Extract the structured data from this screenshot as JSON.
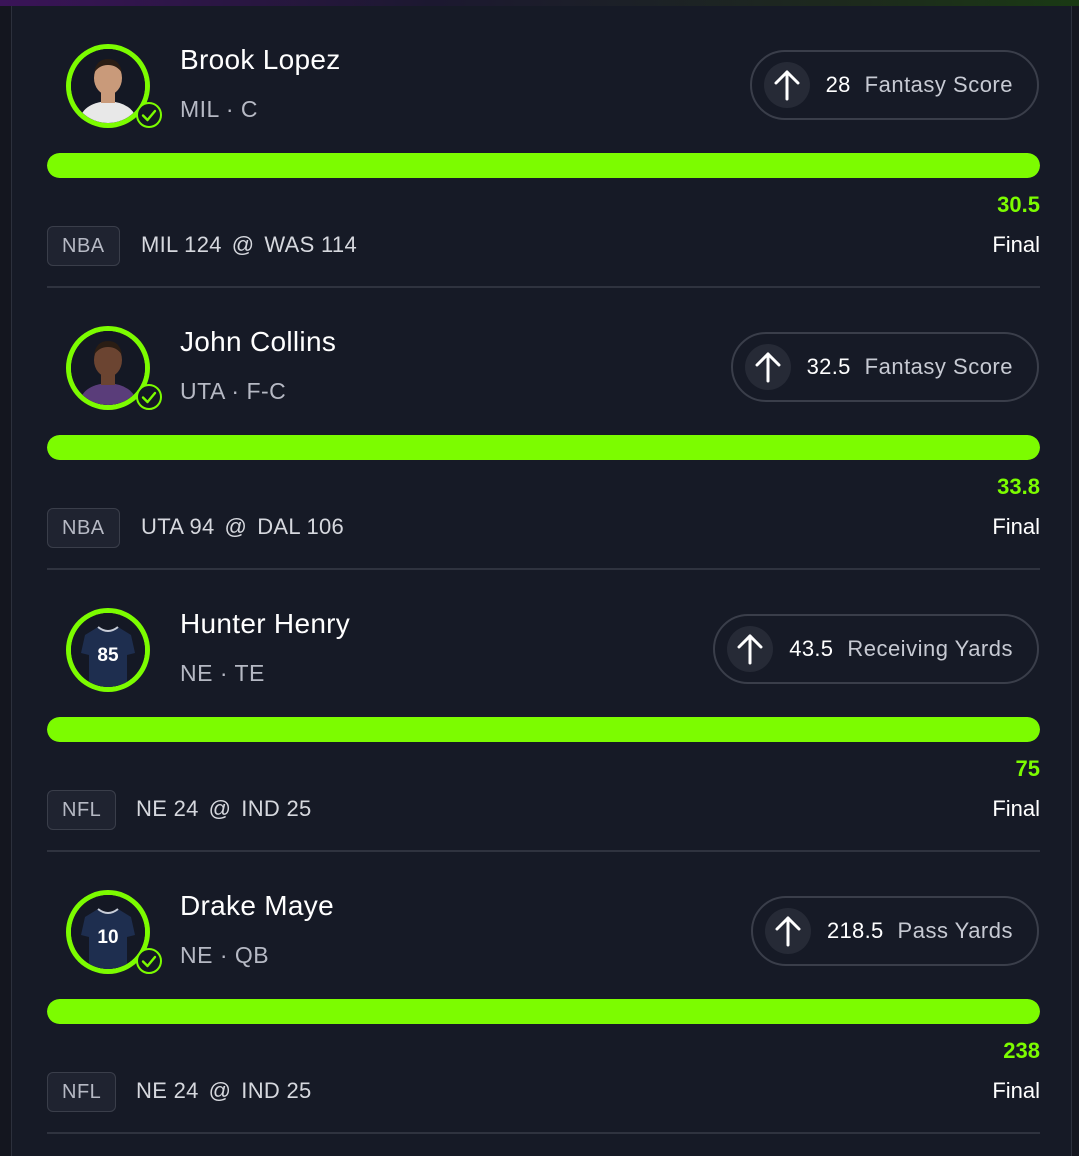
{
  "colors": {
    "accent": "#7cfc00",
    "background": "#161a26",
    "text": "#ffffff",
    "muted": "#b6b9c4"
  },
  "picks": [
    {
      "player_name": "Brook Lopez",
      "team_position": "MIL · C",
      "direction_icon": "arrow-up-icon",
      "line": "28",
      "stat_type": "Fantasy Score",
      "progress": 1.0,
      "actual": "30.5",
      "league": "NBA",
      "away_team": "MIL 124",
      "at": "@",
      "home_team": "WAS 114",
      "status": "Final",
      "avatar": "basketball-headshot",
      "jersey_number": "",
      "checked": true
    },
    {
      "player_name": "John Collins",
      "team_position": "UTA · F-C",
      "direction_icon": "arrow-up-icon",
      "line": "32.5",
      "stat_type": "Fantasy Score",
      "progress": 1.0,
      "actual": "33.8",
      "league": "NBA",
      "away_team": "UTA 94",
      "at": "@",
      "home_team": "DAL 106",
      "status": "Final",
      "avatar": "basketball-headshot",
      "jersey_number": "",
      "checked": true
    },
    {
      "player_name": "Hunter Henry",
      "team_position": "NE · TE",
      "direction_icon": "arrow-up-icon",
      "line": "43.5",
      "stat_type": "Receiving Yards",
      "progress": 1.0,
      "actual": "75",
      "league": "NFL",
      "away_team": "NE 24",
      "at": "@",
      "home_team": "IND 25",
      "status": "Final",
      "avatar": "football-jersey",
      "jersey_number": "85",
      "checked": false
    },
    {
      "player_name": "Drake Maye",
      "team_position": "NE · QB",
      "direction_icon": "arrow-up-icon",
      "line": "218.5",
      "stat_type": "Pass Yards",
      "progress": 1.0,
      "actual": "238",
      "league": "NFL",
      "away_team": "NE 24",
      "at": "@",
      "home_team": "IND 25",
      "status": "Final",
      "avatar": "football-jersey",
      "jersey_number": "10",
      "checked": true
    }
  ]
}
